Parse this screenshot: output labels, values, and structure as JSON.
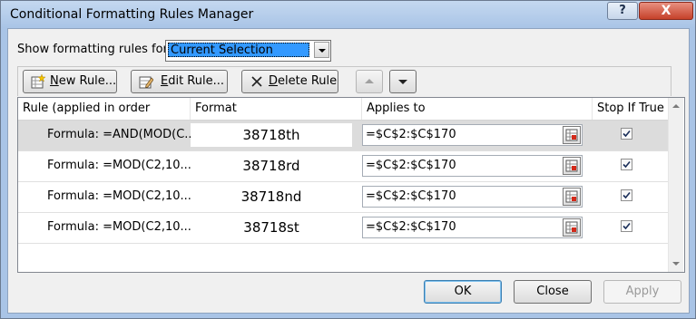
{
  "window": {
    "title": "Conditional Formatting Rules Manager",
    "help_glyph": "?",
    "close_glyph": "X"
  },
  "filter": {
    "label": "Show formatting rules for:",
    "selected": "Current Selection"
  },
  "toolbar": {
    "new_rule": {
      "mnemonic": "N",
      "rest": "ew Rule..."
    },
    "edit_rule": {
      "mnemonic": "E",
      "rest": "dit Rule..."
    },
    "delete_rule": {
      "mnemonic": "D",
      "rest": "elete Rule"
    }
  },
  "columns": {
    "rule": "Rule (applied in order shown)",
    "format": "Format",
    "applies_to": "Applies to",
    "stop_if_true": "Stop If True"
  },
  "rules": [
    {
      "rule": "Formula: =AND(MOD(C...",
      "format": "38718th",
      "applies_to": "=$C$2:$C$170",
      "stop_if_true": true,
      "selected": true
    },
    {
      "rule": "Formula: =MOD(C2,10...",
      "format": "38718rd",
      "applies_to": "=$C$2:$C$170",
      "stop_if_true": true,
      "selected": false
    },
    {
      "rule": "Formula: =MOD(C2,10...",
      "format": "38718nd",
      "applies_to": "=$C$2:$C$170",
      "stop_if_true": true,
      "selected": false
    },
    {
      "rule": "Formula: =MOD(C2,10...",
      "format": "38718st",
      "applies_to": "=$C$2:$C$170",
      "stop_if_true": true,
      "selected": false
    }
  ],
  "buttons": {
    "ok": "OK",
    "close": "Close",
    "apply": "Apply"
  },
  "colors": {
    "selection_highlight": "#3399ff",
    "selected_row": "#dcdcdc",
    "title_bar": "#a9c4e6",
    "close_button": "#c5412a"
  }
}
